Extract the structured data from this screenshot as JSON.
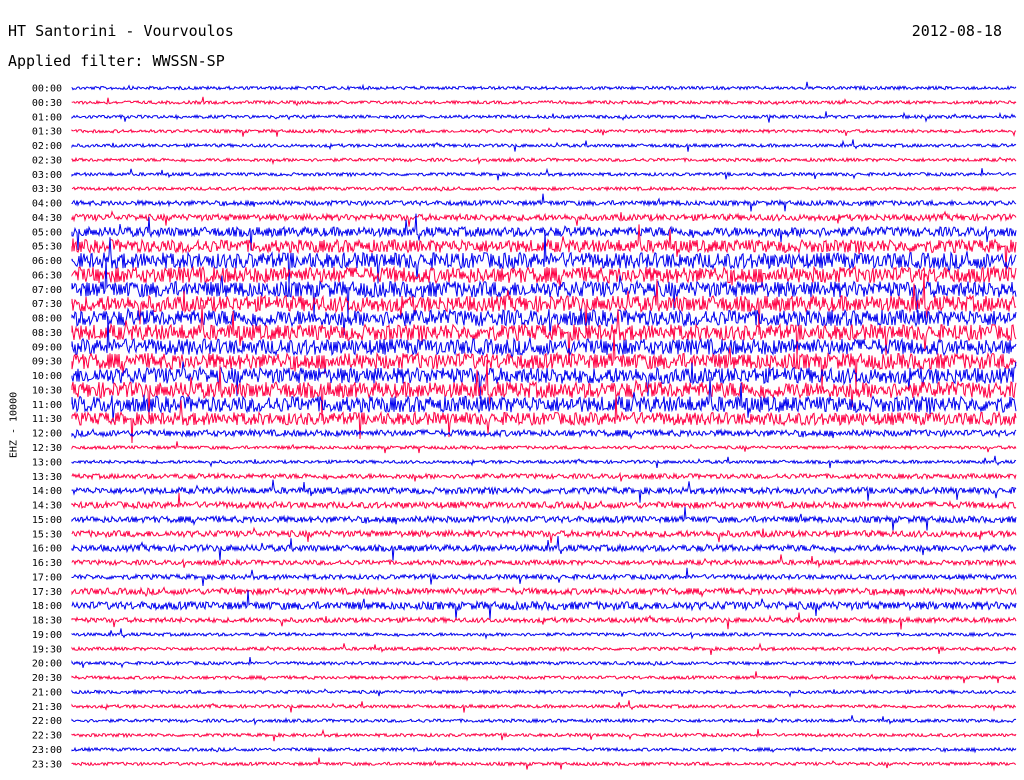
{
  "header": {
    "station": "HT Santorini - Vourvoulos",
    "date": "2012-08-18",
    "filter": "Applied filter: WWSSN-SP"
  },
  "chart_data": {
    "type": "line",
    "title": "HT Santorini - Vourvoulos",
    "subtitle": "Applied filter: WWSSN-SP",
    "ylabel": "EHZ - 10000",
    "tick_labels": [
      "00:00",
      "00:30",
      "01:00",
      "01:30",
      "02:00",
      "02:30",
      "03:00",
      "03:30",
      "04:00",
      "04:30",
      "05:00",
      "05:30",
      "06:00",
      "06:30",
      "07:00",
      "07:30",
      "08:00",
      "08:30",
      "09:00",
      "09:30",
      "10:00",
      "10:30",
      "11:00",
      "11:30",
      "12:00",
      "12:30",
      "13:00",
      "13:30",
      "14:00",
      "14:30",
      "15:00",
      "15:30",
      "16:00",
      "16:30",
      "17:00",
      "17:30",
      "18:00",
      "18:30",
      "19:00",
      "19:30",
      "20:00",
      "20:30",
      "21:00",
      "21:30",
      "22:00",
      "22:30",
      "23:00",
      "23:30"
    ],
    "colors": {
      "even": "#0000ee",
      "odd": "#ff0044"
    },
    "row_amplitude": [
      1,
      1,
      1,
      1,
      1,
      1,
      1,
      1,
      1.5,
      2,
      3,
      4,
      5,
      5,
      5,
      5,
      5,
      5,
      5,
      5,
      5,
      5,
      5,
      4,
      2,
      1,
      1,
      1.5,
      2,
      2,
      2,
      2,
      2,
      1.5,
      1.5,
      2,
      2.5,
      1.5,
      1,
      1,
      1,
      1,
      1,
      1,
      1,
      1,
      1,
      1
    ]
  }
}
